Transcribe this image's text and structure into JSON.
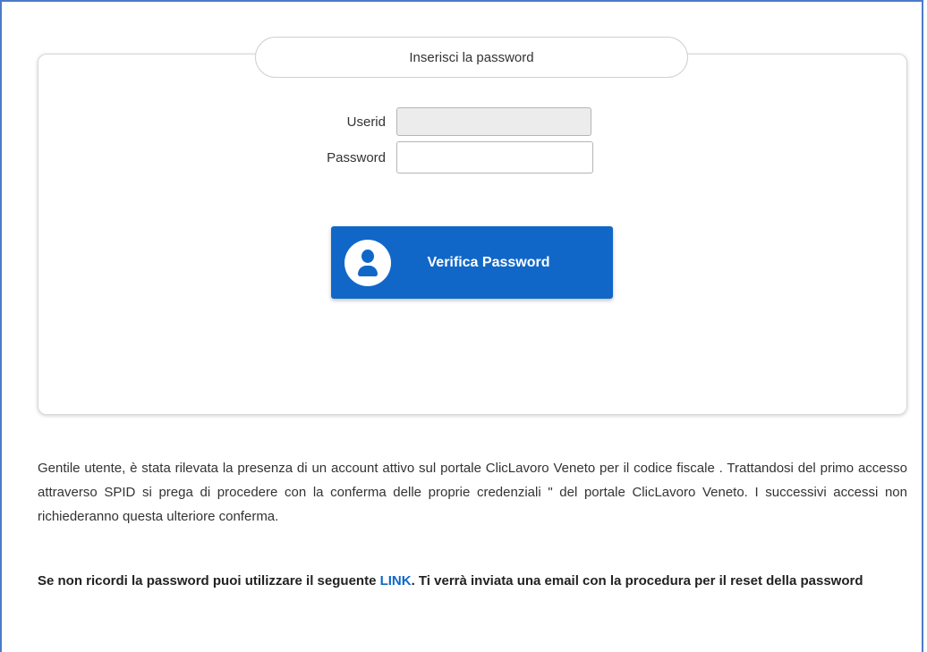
{
  "login": {
    "panel_title": "Inserisci la password",
    "userid_label": "Userid",
    "userid_value": "",
    "password_label": "Password",
    "password_value": "",
    "verify_button_label": "Verifica Password",
    "verify_button_icon": "user-icon"
  },
  "info": {
    "message": "Gentile utente, è stata rilevata la presenza di un account attivo sul portale ClicLavoro Veneto per il codice fiscale . Trattandosi del primo accesso attraverso SPID si prega di procedere con la conferma delle proprie credenziali \" del portale ClicLavoro Veneto. I successivi accessi non richiederanno questa ulteriore conferma."
  },
  "reset": {
    "text_before": "Se non ricordi la password puoi utilizzare il seguente ",
    "link_label": "LINK",
    "text_after": ". Ti verrà inviata una email con la procedura per il reset della password"
  },
  "colors": {
    "accent": "#1167c8",
    "frame_border": "#4a7bc8",
    "disabled_field": "#ececec"
  }
}
